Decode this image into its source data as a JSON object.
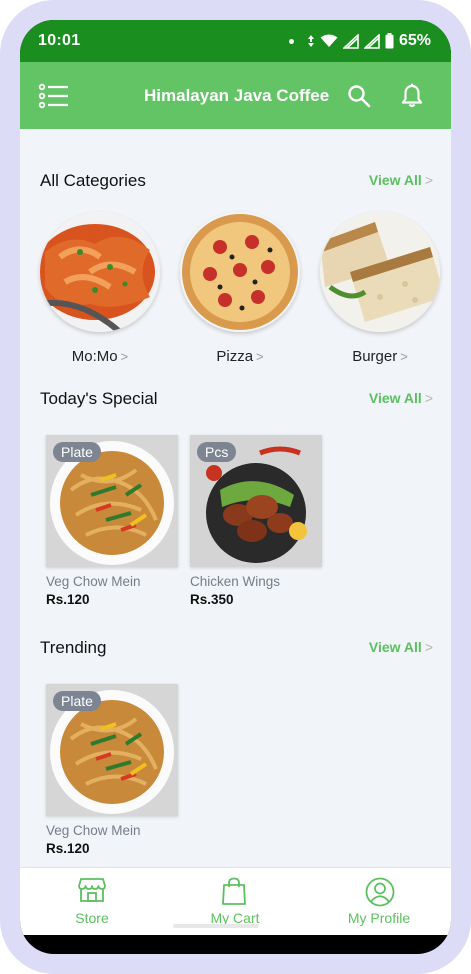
{
  "status_bar": {
    "time": "10:01",
    "battery": "65%"
  },
  "app_bar": {
    "title": "Himalayan Java Coffee"
  },
  "sections": {
    "categories": {
      "title": "All Categories",
      "view_all": "View All"
    },
    "special": {
      "title": "Today's Special",
      "view_all": "View All"
    },
    "trending": {
      "title": "Trending",
      "view_all": "View All"
    }
  },
  "categories": [
    {
      "label": "Mo:Mo"
    },
    {
      "label": "Pizza"
    },
    {
      "label": "Burger"
    }
  ],
  "todays_special": [
    {
      "unit": "Plate",
      "name": "Veg Chow Mein",
      "price": "Rs.120"
    },
    {
      "unit": "Pcs",
      "name": "Chicken Wings",
      "price": "Rs.350"
    }
  ],
  "trending": [
    {
      "unit": "Plate",
      "name": "Veg Chow Mein",
      "price": "Rs.120"
    }
  ],
  "bottom_nav": {
    "store": "Store",
    "cart": "My Cart",
    "profile": "My Profile"
  },
  "colors": {
    "status_bar": "#1a8e1f",
    "app_bar": "#63c466",
    "accent": "#5cc060",
    "background": "#f1f4f8"
  }
}
